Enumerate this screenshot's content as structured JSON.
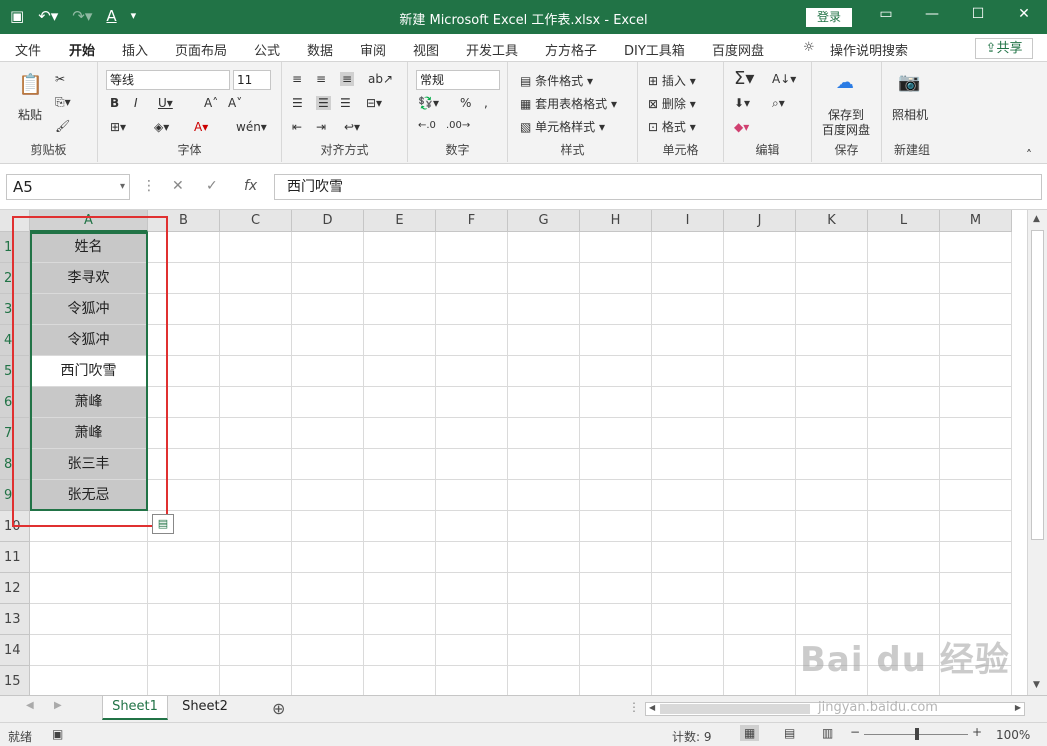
{
  "titlebar": {
    "title": "新建 Microsoft Excel 工作表.xlsx  -  Excel",
    "login": "登录"
  },
  "menu": {
    "tabs": [
      "文件",
      "开始",
      "插入",
      "页面布局",
      "公式",
      "数据",
      "审阅",
      "视图",
      "开发工具",
      "方方格子",
      "DIY工具箱",
      "百度网盘"
    ],
    "tell_me": "操作说明搜索",
    "share": "共享"
  },
  "ribbon": {
    "clipboard": {
      "label": "剪贴板",
      "paste": "粘贴"
    },
    "font": {
      "label": "字体",
      "name": "等线",
      "size": "11"
    },
    "align": {
      "label": "对齐方式"
    },
    "number": {
      "label": "数字",
      "format": "常规"
    },
    "styles": {
      "label": "样式",
      "cond": "条件格式",
      "table": "套用表格格式",
      "cell": "单元格样式"
    },
    "cells": {
      "label": "单元格",
      "insert": "插入",
      "delete": "删除",
      "format": "格式"
    },
    "edit": {
      "label": "编辑"
    },
    "save": {
      "label": "保存",
      "btn1": "保存到",
      "btn2": "百度网盘"
    },
    "newgroup": {
      "label": "新建组",
      "camera": "照相机"
    }
  },
  "formula": {
    "namebox": "A5",
    "fx": "fx",
    "value": "西门吹雪"
  },
  "grid": {
    "columns": [
      "A",
      "B",
      "C",
      "D",
      "E",
      "F",
      "G",
      "H",
      "I",
      "J",
      "K",
      "L",
      "M"
    ],
    "rows": [
      "1",
      "2",
      "3",
      "4",
      "5",
      "6",
      "7",
      "8",
      "9",
      "10",
      "11",
      "12",
      "13",
      "14",
      "15"
    ],
    "a_values": [
      "姓名",
      "李寻欢",
      "令狐冲",
      "令狐冲",
      "西门吹雪",
      "萧峰",
      "萧峰",
      "张三丰",
      "张无忌"
    ]
  },
  "sheets": {
    "tabs": [
      "Sheet1",
      "Sheet2"
    ]
  },
  "status": {
    "ready": "就绪",
    "count": "计数: 9",
    "zoom": "100%"
  },
  "watermark": {
    "brand": "Bai du 经验",
    "url": "jingyan.baidu.com"
  }
}
